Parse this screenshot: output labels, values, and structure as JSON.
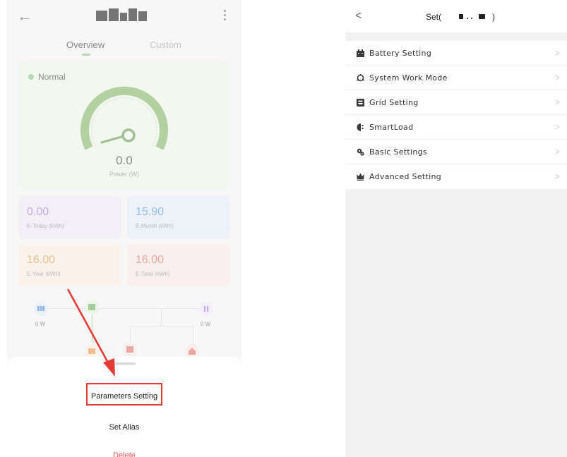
{
  "left_screen": {
    "tabs": [
      {
        "label": "Overview",
        "active": true
      },
      {
        "label": "Custom",
        "active": false
      }
    ],
    "status": {
      "label": "Normal",
      "color": "#7dc17a"
    },
    "power": {
      "value": "0.0",
      "label": "Power (W)"
    },
    "stats": [
      {
        "value": "0.00",
        "label": "E-Today (kWh)",
        "color": "#9b6fd0"
      },
      {
        "value": "15.90",
        "label": "E-Month (kWh)",
        "color": "#4a8ed6"
      },
      {
        "value": "16.00",
        "label": "E-Year (kWh)",
        "color": "#e5913e"
      },
      {
        "value": "16.00",
        "label": "E-Total (kWh)",
        "color": "#e06a5e"
      }
    ],
    "flow": {
      "solar_power": "0 W",
      "grid_power": "0 W"
    },
    "sheet": {
      "parameters_label": "Parameters Setting",
      "alias_label": "Set Alias",
      "delete_label": "Delete"
    }
  },
  "right_screen": {
    "title": "Set(",
    "title_suffix": ")",
    "items": [
      {
        "label": "Battery Setting",
        "icon": "battery-icon"
      },
      {
        "label": "System Work Mode",
        "icon": "mode-icon"
      },
      {
        "label": "Grid Setting",
        "icon": "grid-icon"
      },
      {
        "label": "SmartLoad",
        "icon": "smartload-icon"
      },
      {
        "label": "Basic Settings",
        "icon": "basic-settings-icon"
      },
      {
        "label": "Advanced Setting",
        "icon": "advanced-setting-icon"
      }
    ]
  },
  "colors": {
    "highlight": "#e53935",
    "delete": "#e8534a",
    "accent_green": "#7dc17a"
  }
}
